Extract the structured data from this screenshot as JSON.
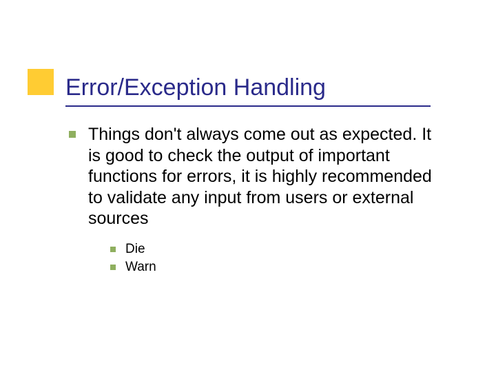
{
  "title": "Error/Exception Handling",
  "body": {
    "point": "Things don't always come out as expected. It is good to check the output of important functions for errors, it is highly recommended to validate any input from users or external sources",
    "subitems": [
      "Die",
      "Warn"
    ]
  }
}
